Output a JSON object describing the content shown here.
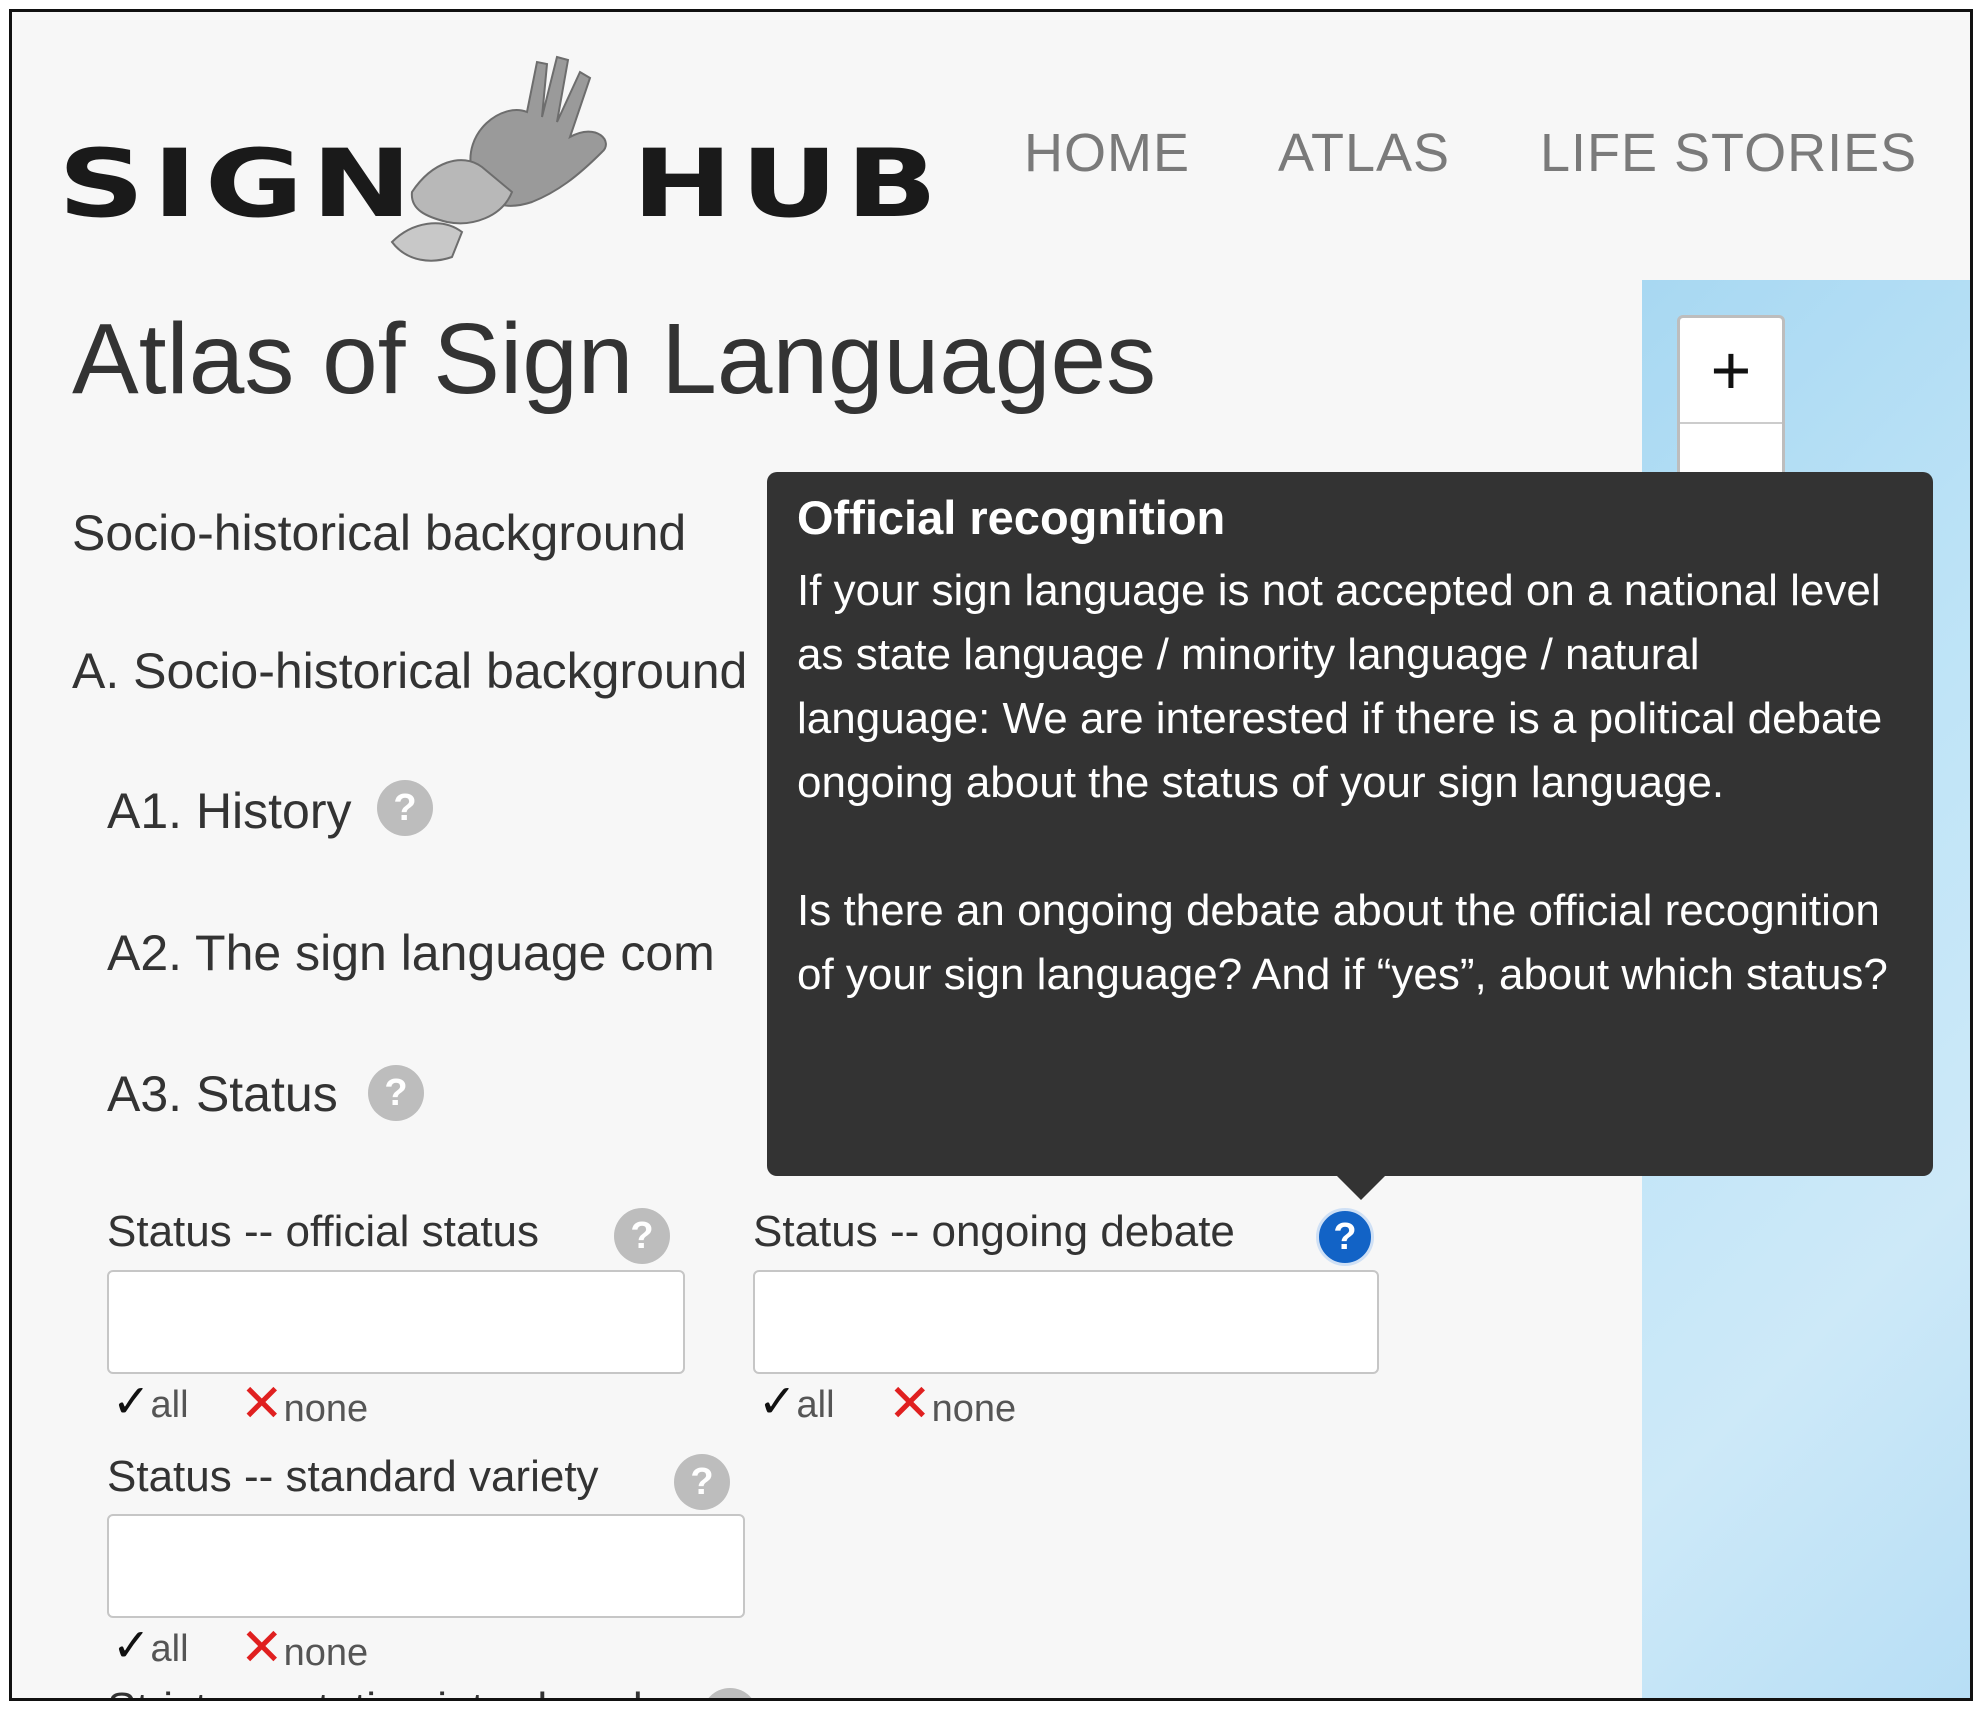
{
  "header": {
    "logo_left": "SIGN",
    "logo_right": "HUB",
    "nav": [
      "HOME",
      "ATLAS",
      "LIFE STORIES"
    ]
  },
  "main": {
    "title": "Atlas of Sign Languages",
    "section_1": "Socio-historical background",
    "section_2": "A. Socio-historical background",
    "a1": "A1. History",
    "a2": "A2. The sign language com",
    "a3": "A3. Status",
    "help_glyph": "?"
  },
  "fields": {
    "official_status": {
      "label": "Status -- official status",
      "value": ""
    },
    "ongoing_debate": {
      "label": "Status -- ongoing debate",
      "value": ""
    },
    "standard_variety": {
      "label": "Status -- standard variety",
      "value": ""
    },
    "partial_next": "Strict annotation introduced"
  },
  "controls": {
    "all": "all",
    "none": "none",
    "check": "✓",
    "cross": "✕"
  },
  "map": {
    "zoom_in": "+"
  },
  "tooltip": {
    "title": "Official recognition",
    "body": "If your sign language is not accepted on a national level as state language / minority language / natural language: We are interested if there is a political debate ongoing about the status of your sign language.\n\nIs there an ongoing debate about the official recognition of your sign language? And if “yes”, about which status?"
  },
  "colors": {
    "active_help": "#1263c6",
    "cross": "#e02020",
    "tooltip_bg": "#333333",
    "map": "#bfe4f7"
  }
}
